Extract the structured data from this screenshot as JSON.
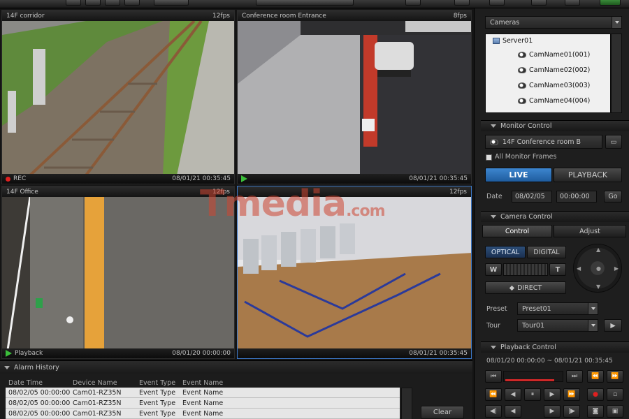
{
  "panes": [
    {
      "title": "14F corridor",
      "fps": "12fps",
      "status": "REC",
      "timestamp": "08/01/21 00:35:45",
      "status_icon": "rec-dot"
    },
    {
      "title": "Conference room Entrance",
      "fps": "8fps",
      "status": "",
      "timestamp": "08/01/21 00:35:45",
      "status_icon": "play-icon"
    },
    {
      "title": "14F Office",
      "fps": "12fps",
      "status": "Playback",
      "timestamp": "08/01/20 00:00:00",
      "status_icon": "play-icon"
    },
    {
      "title": "",
      "fps": "12fps",
      "status": "",
      "timestamp": "08/01/21 00:35:45",
      "status_icon": ""
    }
  ],
  "watermark": {
    "text": "Tmedia",
    "tail": ".com"
  },
  "alarm_history": {
    "title": "Alarm History",
    "columns": [
      "Date Time",
      "Device Name",
      "Event Type",
      "Event Name"
    ],
    "rows": [
      [
        "08/02/05 00:00:00",
        "Cam01-RZ35N",
        "Event Type",
        "Event Name"
      ],
      [
        "08/02/05 00:00:00",
        "Cam01-RZ35N",
        "Event Type",
        "Event Name"
      ],
      [
        "08/02/05 00:00:00",
        "Cam01-RZ35N",
        "Event Type",
        "Event Name"
      ]
    ],
    "clear_label": "Clear"
  },
  "cameras": {
    "combo_value": "Cameras",
    "server": "Server01",
    "items": [
      "CamName01(001)",
      "CamName02(002)",
      "CamName03(003)",
      "CamName04(004)"
    ]
  },
  "monitor_control": {
    "title": "Monitor Control",
    "monitor_name": "14F Conference room B",
    "all_frames_label": "All Monitor Frames",
    "live_label": "LIVE",
    "playback_label": "PLAYBACK",
    "date_label": "Date",
    "date_value": "08/02/05",
    "time_value": "00:00:00",
    "go_label": "Go"
  },
  "camera_control": {
    "title": "Camera Control",
    "tab_control": "Control",
    "tab_adjust": "Adjust",
    "optical_label": "OPTICAL",
    "digital_label": "DIGITAL",
    "wide_label": "W",
    "tele_label": "T",
    "direct_label": "DIRECT",
    "preset_label": "Preset",
    "preset_value": "Preset01",
    "tour_label": "Tour",
    "tour_value": "Tour01"
  },
  "playback_control": {
    "title": "Playback Control",
    "range_start": "08/01/20 00:00:00",
    "range_sep": "~",
    "range_end": "08/01/21 00:35:45"
  },
  "colors": {
    "accent": "#3d86cf",
    "rec": "#e02020",
    "play": "#3bbf3b"
  }
}
